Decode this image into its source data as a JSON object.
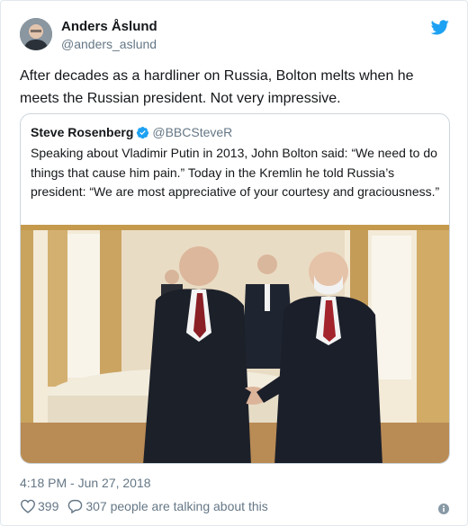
{
  "author": {
    "name": "Anders Åslund",
    "handle": "@anders_aslund"
  },
  "tweet": {
    "text": "After decades as a hardliner on Russia, Bolton melts when he meets the Russian president. Not very impressive."
  },
  "quoted": {
    "name": "Steve Rosenberg",
    "handle": "@BBCSteveR",
    "text": "Speaking about Vladimir Putin in 2013, John Bolton said: “We need to do things that cause him pain.” Today in the Kremlin he told Russia’s president: “We are most appreciative of your courtesy and graciousness.”",
    "photo_icon": "photo-handshake"
  },
  "meta": {
    "timestamp": "4:18 PM - Jun 27, 2018",
    "likes": "399",
    "talking": "307 people are talking about this"
  },
  "icons": {
    "brand": "twitter-bird-icon",
    "verified": "verified-badge-icon",
    "like": "heart-icon",
    "reply": "speech-bubble-icon",
    "info": "info-icon"
  },
  "colors": {
    "brand": "#1da1f2",
    "text": "#14171a",
    "muted": "#657786",
    "border": "#e1e8ed",
    "quote_border": "#ccd6dd"
  }
}
